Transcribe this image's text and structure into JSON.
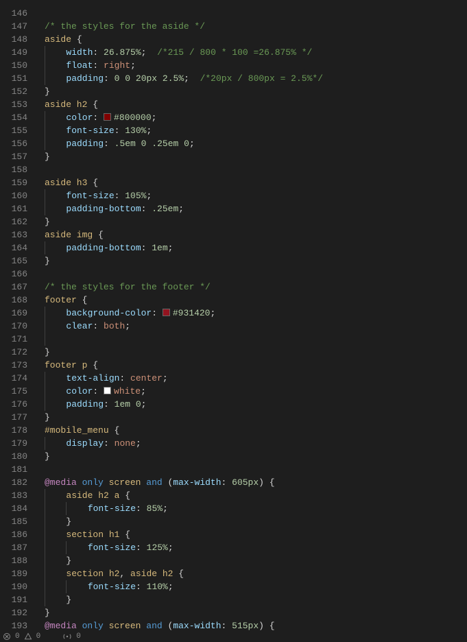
{
  "lineStart": 146,
  "lines": [
    {
      "n": 146,
      "t": ""
    },
    {
      "n": 147,
      "t": "comment",
      "txt": "/* the styles for the aside */"
    },
    {
      "n": 148,
      "sel": "aside",
      "open": true
    },
    {
      "n": 149,
      "indent": 1,
      "prop": "width",
      "val": "26.875%",
      "after_comment": "/*215 / 800 * 100 =26.875% */"
    },
    {
      "n": 150,
      "indent": 1,
      "prop": "float",
      "val": "right"
    },
    {
      "n": 151,
      "indent": 1,
      "prop": "padding",
      "val": "0 0 20px 2.5%",
      "after_comment": "/*20px / 800px = 2.5%*/"
    },
    {
      "n": 152,
      "close": true
    },
    {
      "n": 153,
      "sel": "aside h2",
      "open": true
    },
    {
      "n": 154,
      "indent": 1,
      "prop": "color",
      "swatch": "#800000",
      "val": "#800000"
    },
    {
      "n": 155,
      "indent": 1,
      "prop": "font-size",
      "val": "130%"
    },
    {
      "n": 156,
      "indent": 1,
      "prop": "padding",
      "val": ".5em 0 .25em 0"
    },
    {
      "n": 157,
      "close": true
    },
    {
      "n": 158,
      "t": ""
    },
    {
      "n": 159,
      "sel": "aside h3",
      "open": true
    },
    {
      "n": 160,
      "indent": 1,
      "prop": "font-size",
      "val": "105%"
    },
    {
      "n": 161,
      "indent": 1,
      "prop": "padding-bottom",
      "val": ".25em"
    },
    {
      "n": 162,
      "close": true
    },
    {
      "n": 163,
      "sel": "aside img",
      "open": true
    },
    {
      "n": 164,
      "indent": 1,
      "prop": "padding-bottom",
      "val": "1em"
    },
    {
      "n": 165,
      "close": true
    },
    {
      "n": 166,
      "t": ""
    },
    {
      "n": 167,
      "t": "comment",
      "txt": "/* the styles for the footer */"
    },
    {
      "n": 168,
      "sel": "footer",
      "open": true
    },
    {
      "n": 169,
      "indent": 1,
      "prop": "background-color",
      "swatch": "#931420",
      "val": "#931420"
    },
    {
      "n": 170,
      "indent": 1,
      "prop": "clear",
      "val": "both"
    },
    {
      "n": 171,
      "indent": 1,
      "blank": true
    },
    {
      "n": 172,
      "close": true
    },
    {
      "n": 173,
      "sel": "footer p",
      "open": true
    },
    {
      "n": 174,
      "indent": 1,
      "prop": "text-align",
      "val": "center"
    },
    {
      "n": 175,
      "indent": 1,
      "prop": "color",
      "swatch": "#ffffff",
      "val": "white"
    },
    {
      "n": 176,
      "indent": 1,
      "prop": "padding",
      "val": "1em 0"
    },
    {
      "n": 177,
      "close": true
    },
    {
      "n": 178,
      "sel": "#mobile_menu",
      "open": true
    },
    {
      "n": 179,
      "indent": 1,
      "prop": "display",
      "val": "none"
    },
    {
      "n": 180,
      "close": true
    },
    {
      "n": 181,
      "t": ""
    },
    {
      "n": 182,
      "media": {
        "mw": "605px"
      },
      "open": true
    },
    {
      "n": 183,
      "indent": 1,
      "sel": "aside h2 a",
      "open": true
    },
    {
      "n": 184,
      "indent": 2,
      "prop": "font-size",
      "val": "85%"
    },
    {
      "n": 185,
      "indent": 1,
      "close": true
    },
    {
      "n": 186,
      "indent": 1,
      "sel": "section h1",
      "open": true
    },
    {
      "n": 187,
      "indent": 2,
      "prop": "font-size",
      "val": "125%"
    },
    {
      "n": 188,
      "indent": 1,
      "close": true
    },
    {
      "n": 189,
      "indent": 1,
      "sel": "section h2, aside h2",
      "open": true
    },
    {
      "n": 190,
      "indent": 2,
      "prop": "font-size",
      "val": "110%"
    },
    {
      "n": 191,
      "indent": 1,
      "close": true
    },
    {
      "n": 192,
      "close": true
    },
    {
      "n": 193,
      "media": {
        "mw": "515px"
      },
      "open": true
    }
  ],
  "status": {
    "err": "0",
    "warn": "0",
    "radio": "0"
  }
}
